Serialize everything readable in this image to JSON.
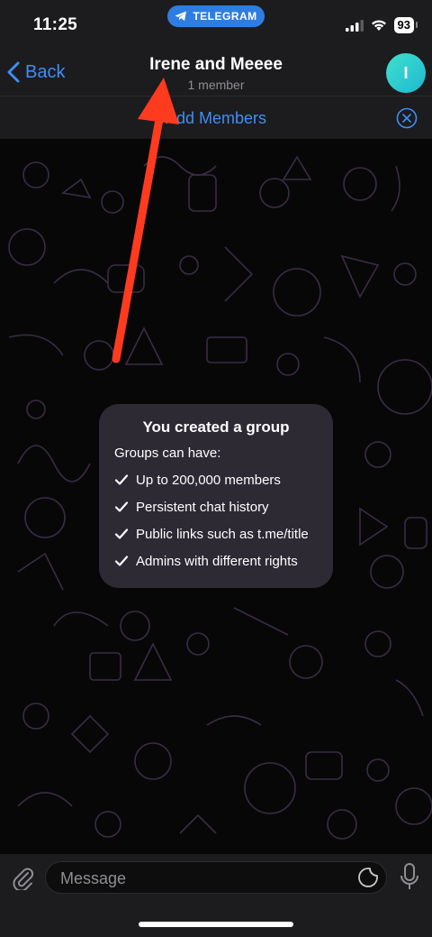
{
  "status_bar": {
    "time": "11:25",
    "app_pill": "TELEGRAM",
    "battery": "93"
  },
  "header": {
    "back_label": "Back",
    "title": "Irene and Meeee",
    "subtitle": "1 member",
    "avatar_initial": "I"
  },
  "banner": {
    "add_members_label": "Add Members"
  },
  "service_card": {
    "title": "You created a group",
    "subtitle": "Groups can have:",
    "items": [
      "Up to 200,000 members",
      "Persistent chat history",
      "Public links such as t.me/title",
      "Admins with different rights"
    ]
  },
  "composer": {
    "placeholder": "Message"
  },
  "colors": {
    "accent": "#3e8ef7",
    "bar_bg": "#1c1c1e",
    "annotation_arrow": "#ff3b1f",
    "avatar": "#2fc9d0"
  }
}
